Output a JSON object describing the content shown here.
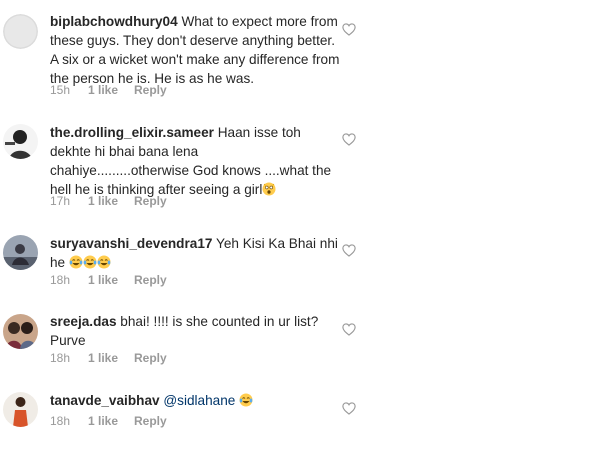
{
  "comments": [
    {
      "username": "biplabchowdhury04",
      "text": "What to expect more from these guys. They don't deserve anything better. A six or a wicket won't make any difference from the person he is.  He is as he was.",
      "time": "15h",
      "likes": "1 like",
      "reply": "Reply",
      "avatar_icon": "default-avatar-icon"
    },
    {
      "username": "the.drolling_elixir.sameer",
      "text": "Haan isse toh dekhte hi bhai bana lena chahiye.........otherwise God knows ....what the hell he is thinking after seeing a girl",
      "emoji": "shocked-face-emoji",
      "time": "17h",
      "likes": "1 like",
      "reply": "Reply",
      "avatar_icon": "profile-photo-icon"
    },
    {
      "username": "suryavanshi_devendra17",
      "text": "Yeh Kisi Ka Bhai nhi he",
      "emoji": "tears-of-joy-emoji",
      "emoji_count": 3,
      "time": "18h",
      "likes": "1 like",
      "reply": "Reply",
      "avatar_icon": "profile-photo-icon"
    },
    {
      "username": "sreeja.das",
      "text": "bhai! !!!! is she counted in ur list? Purve",
      "time": "18h",
      "likes": "1 like",
      "reply": "Reply",
      "avatar_icon": "profile-photo-icon"
    },
    {
      "username": "tanavde_vaibhav",
      "mention": "@sidlahane",
      "emoji": "tears-of-joy-emoji",
      "time": "18h",
      "likes": "1 like",
      "reply": "Reply",
      "avatar_icon": "profile-photo-icon"
    }
  ],
  "colors": {
    "text": "#262626",
    "meta": "#999999",
    "mention": "#003569",
    "heart_outline": "#999999"
  }
}
